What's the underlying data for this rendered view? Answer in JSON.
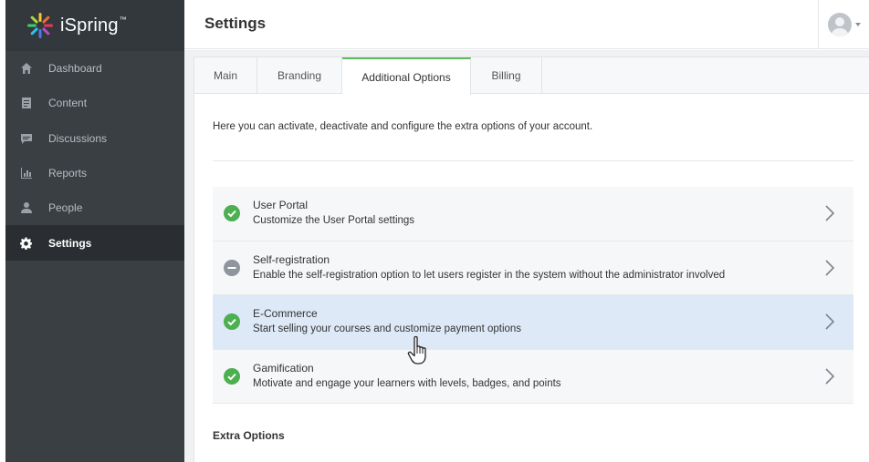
{
  "app": {
    "logo_text": "iSpring",
    "logo_mark": "™"
  },
  "sidebar": {
    "items": [
      {
        "label": "Dashboard",
        "icon": "home-icon"
      },
      {
        "label": "Content",
        "icon": "document-icon"
      },
      {
        "label": "Discussions",
        "icon": "chat-icon"
      },
      {
        "label": "Reports",
        "icon": "bar-chart-icon"
      },
      {
        "label": "People",
        "icon": "person-icon"
      },
      {
        "label": "Settings",
        "icon": "gear-icon",
        "active": true
      }
    ]
  },
  "header": {
    "title": "Settings"
  },
  "tabs": [
    {
      "label": "Main"
    },
    {
      "label": "Branding"
    },
    {
      "label": "Additional Options",
      "active": true
    },
    {
      "label": "Billing"
    }
  ],
  "intro": "Here you can activate, deactivate and configure the extra options of your account.",
  "options": [
    {
      "title": "User Portal",
      "description": "Customize the User Portal settings",
      "status": "enabled"
    },
    {
      "title": "Self-registration",
      "description": "Enable the self-registration option to let users register in the system without the administrator involved",
      "status": "disabled"
    },
    {
      "title": "E-Commerce",
      "description": "Start selling your courses and customize payment options",
      "status": "enabled",
      "hovered": true
    },
    {
      "title": "Gamification",
      "description": "Motivate and engage your learners with levels, badges, and points",
      "status": "enabled"
    }
  ],
  "extra_options_heading": "Extra Options",
  "colors": {
    "sidebar_bg": "#3a3f44",
    "active_tab_accent": "#5cb85c",
    "enabled_status": "#4caf50",
    "disabled_status": "#8e959c",
    "hover_row": "#dde9f7"
  }
}
